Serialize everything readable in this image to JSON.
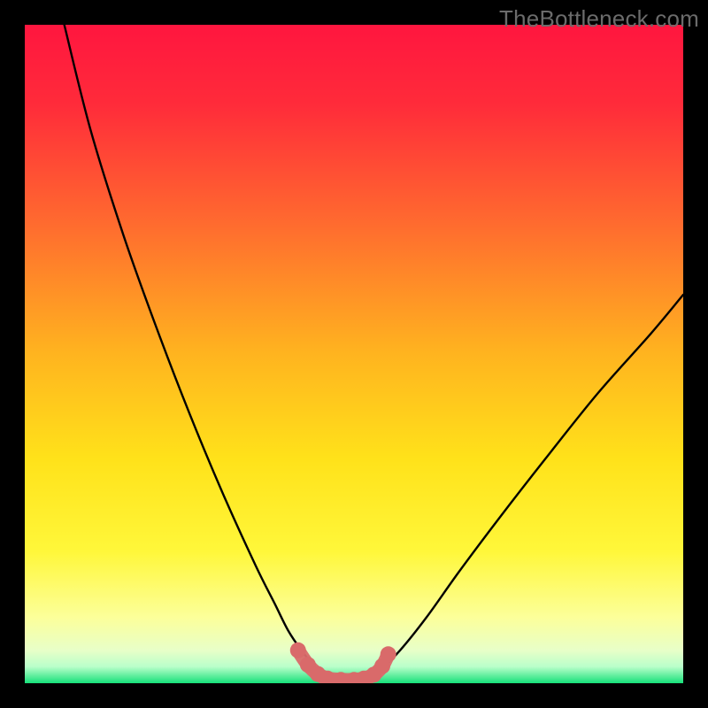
{
  "watermark": "TheBottleneck.com",
  "chart_data": {
    "type": "line",
    "title": "",
    "xlabel": "",
    "ylabel": "",
    "xlim": [
      0,
      100
    ],
    "ylim": [
      0,
      100
    ],
    "background_gradient": {
      "top": "#ff1a3a",
      "upper_mid": "#ff6a2f",
      "mid": "#ffd21a",
      "lower_mid": "#ffff88",
      "bottom_band_pale": "#f6ffd6",
      "bottom": "#16e07a"
    },
    "series": [
      {
        "name": "left-curve",
        "x": [
          6,
          10,
          15,
          20,
          25,
          30,
          35,
          38,
          40,
          42,
          44,
          45.5
        ],
        "y": [
          100,
          84,
          68,
          54,
          41,
          29,
          18,
          12,
          8,
          5,
          2.5,
          0.5
        ],
        "style": "thin-black"
      },
      {
        "name": "right-curve",
        "x": [
          52,
          54,
          57,
          61,
          66,
          72,
          79,
          87,
          95,
          100
        ],
        "y": [
          0.5,
          2,
          5,
          10,
          17,
          25,
          34,
          44,
          53,
          59
        ],
        "style": "thin-black"
      },
      {
        "name": "bottom-marker-band",
        "x": [
          41.5,
          43,
          44.5,
          46,
          48,
          50,
          51.5,
          53,
          54.3,
          55.2
        ],
        "y": [
          5,
          2.8,
          1.4,
          0.7,
          0.5,
          0.5,
          0.7,
          1.3,
          2.6,
          4.4
        ],
        "style": "salmon-thick-dotted"
      }
    ]
  }
}
